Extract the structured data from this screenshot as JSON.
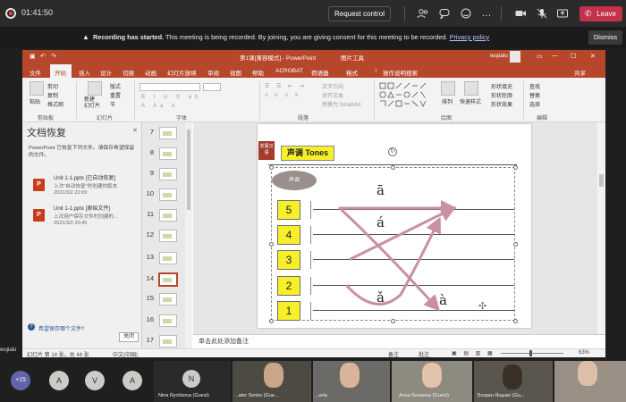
{
  "teams": {
    "timer": "01:41:50",
    "request_control": "Request control",
    "leave": "Leave",
    "icons": [
      "people-icon",
      "chat-icon",
      "reactions-icon",
      "more-icon",
      "camera-icon",
      "mic-off-icon",
      "share-icon",
      "phone-icon"
    ],
    "banner": {
      "lead": "Recording has started.",
      "body": " This meeting is being recorded. By joining, you are giving consent for this meeting to be recorded. ",
      "link": "Privacy policy",
      "dismiss": "Dismiss"
    }
  },
  "ppt": {
    "title": "第1课[兼容模式]  -  PowerPoint",
    "picture_tools": "图片工具",
    "user": "wujialu",
    "tabs": [
      "文件",
      "开始",
      "插入",
      "设计",
      "切换",
      "动画",
      "幻灯片放映",
      "审阅",
      "视图",
      "帮助",
      "ACROBAT",
      "荷语器",
      "格式"
    ],
    "search_hint": "操作说明搜索",
    "share": "共享",
    "ribbon": {
      "groups": [
        "剪贴板",
        "幻灯片",
        "字体",
        "段落",
        "绘图",
        "编辑"
      ],
      "paste": "粘贴",
      "cut": "剪切",
      "copy": "复制",
      "format_painter": "格式刷",
      "new_slide": "新建\n幻灯片",
      "layout": "版式",
      "reset": "重置",
      "section": "节",
      "text_direction": "文字方向",
      "align_text": "对齐文本",
      "smartart": "转换为 SmartArt",
      "arrange": "排列",
      "quick_styles": "快速样式",
      "shape_fill": "形状填充",
      "shape_outline": "形状轮廓",
      "shape_effects": "形状效果",
      "find": "查找",
      "replace": "替换",
      "select": "选择"
    },
    "recovery": {
      "title": "文档恢复",
      "description": "PowerPoint 已恢复下列文件。请保存希望保留的文件。",
      "files": [
        {
          "name": "Unit 1-1.pptx  [已自动恢复]",
          "desc": "上次\"自动恢复\"时创建的版本",
          "time": "2021/3/2 22:09"
        },
        {
          "name": "Unit 1-1.pptx  [原始文件]",
          "desc": "上次用户保存文件时创建的...",
          "time": "2021/3/2 20:45"
        }
      ],
      "question": "希望保存哪个文件?",
      "close": "关闭"
    },
    "thumbnails": [
      "7",
      "8",
      "9",
      "10",
      "11",
      "12",
      "13",
      "14",
      "15",
      "16",
      "17"
    ],
    "selected_slide": "14",
    "notes_placeholder": "单击此处添加备注",
    "status": {
      "slide_info": "幻灯片 第 14 张，共 44 张",
      "language": "中文(中国)",
      "notes": "备注",
      "comments": "批注",
      "zoom": "63%"
    },
    "slide": {
      "logo": "发展汉语",
      "header": "声调 Tones",
      "oval": "声调",
      "levels": [
        "5",
        "4",
        "3",
        "2",
        "1"
      ],
      "pinyin": {
        "tone1": "ā",
        "tone2": "á",
        "tone3": "ǎ",
        "tone4": "à"
      },
      "tone_color": "#c9909f"
    }
  },
  "participants": {
    "self_label": "wujialu",
    "more": "+15",
    "avatars": [
      "A",
      "V",
      "A"
    ],
    "tiles": [
      {
        "initial": "N",
        "name": "Nina Rychkova (Guest)"
      },
      {
        "initial": "",
        "name": "...ater Sonko (Gue..."
      },
      {
        "initial": "",
        "name": "...arla"
      },
      {
        "initial": "",
        "name": "Анна Бонаева (Guest)"
      },
      {
        "initial": "",
        "name": "Богдан Ящыко (Gu..."
      },
      {
        "initial": "",
        "name": ""
      }
    ]
  }
}
